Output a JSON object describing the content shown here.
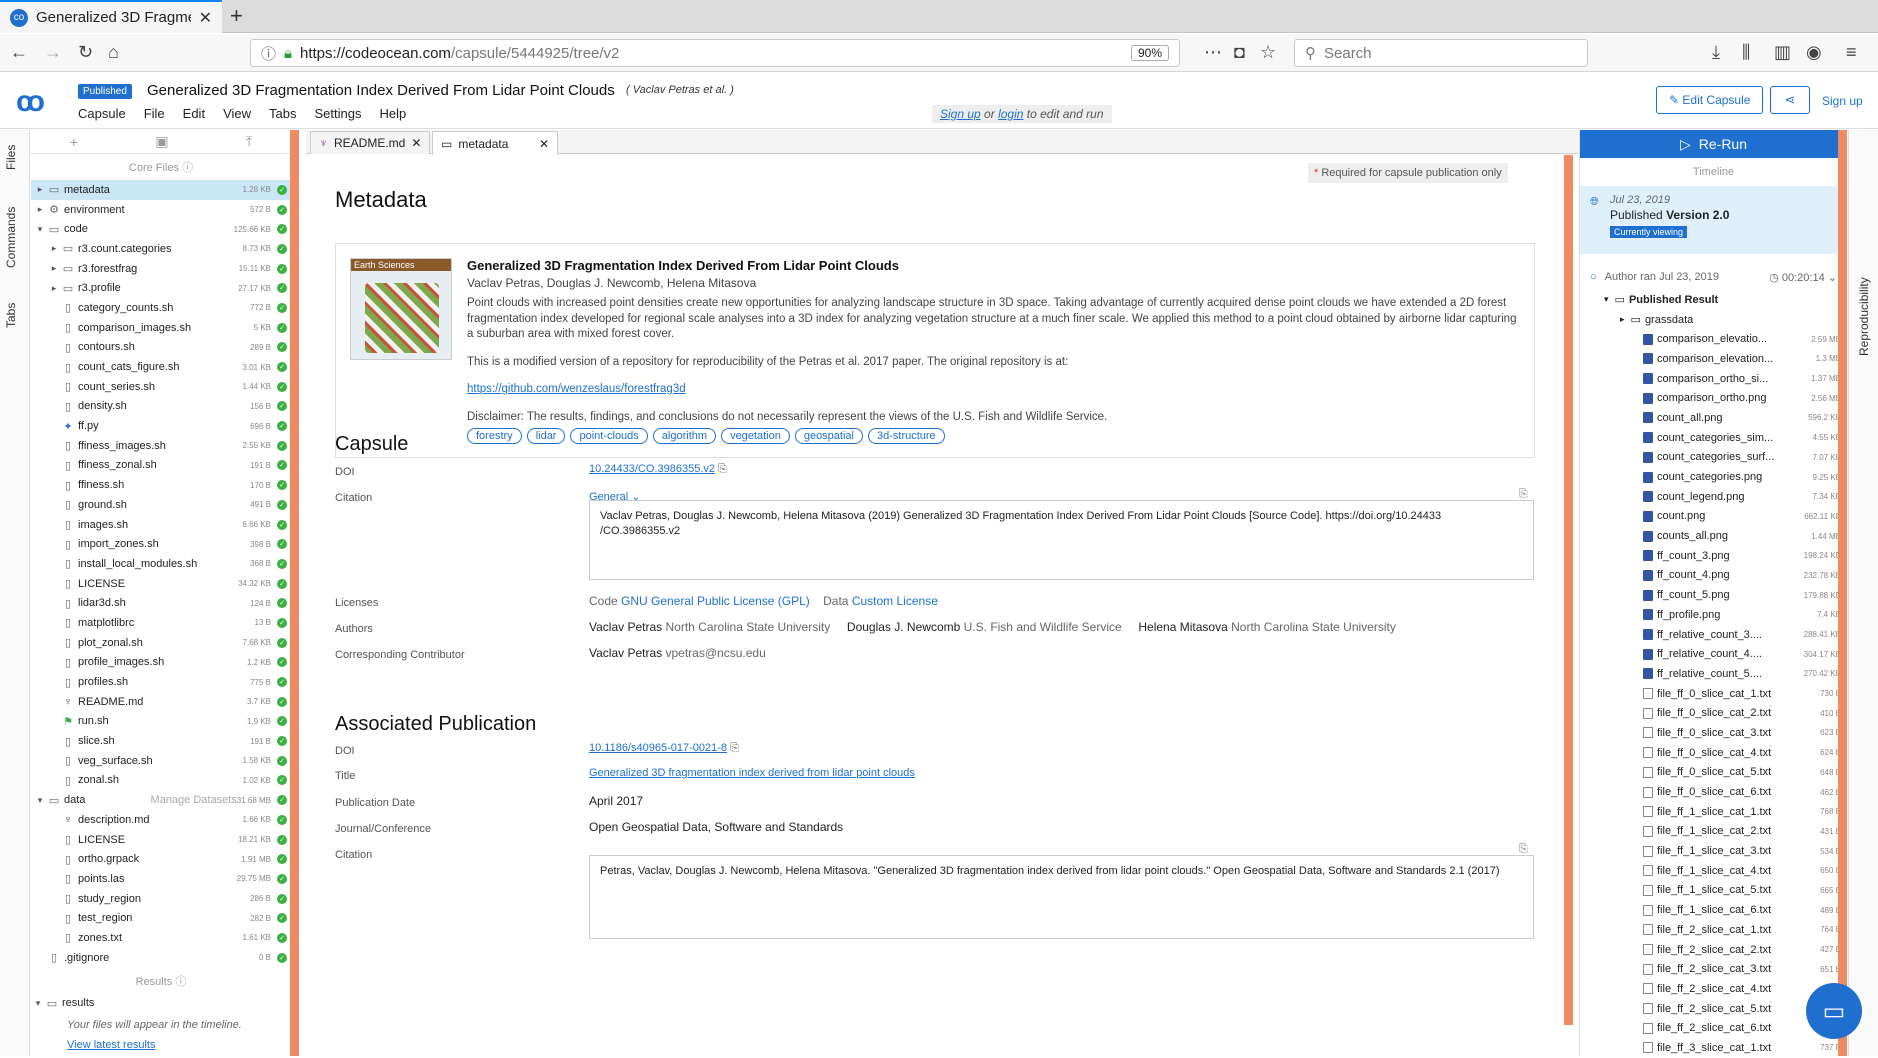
{
  "browser": {
    "tab_title": "Generalized 3D Fragmen",
    "url_host": "https://codeocean.com",
    "url_path": "/capsule/5444925/tree/v2",
    "zoom": "90%",
    "search_placeholder": "Search"
  },
  "app": {
    "badge": "Published",
    "title": "Generalized 3D Fragmentation Index Derived From Lidar Point Clouds",
    "authors": "( Vaclav Petras et al. )",
    "menu": [
      "Capsule",
      "File",
      "Edit",
      "View",
      "Tabs",
      "Settings",
      "Help"
    ],
    "signup_hint_link1": "Sign up",
    "signup_hint_or": "or",
    "signup_hint_link2": "login",
    "signup_hint_rest": "to edit and run",
    "edit_button": "Edit Capsule",
    "signup_button": "Sign up"
  },
  "rails": {
    "files": "Files",
    "commands": "Commands",
    "tabs": "Tabs",
    "reproducibility": "Reproducibility"
  },
  "files": {
    "core_label": "Core Files",
    "results_label": "Results",
    "tree": [
      {
        "name": "metadata",
        "size": "1.28 KB",
        "depth": 0,
        "caret": "▸",
        "icon": "▭",
        "sel": true
      },
      {
        "name": "environment",
        "size": "572 B",
        "depth": 0,
        "caret": "▸",
        "icon": "⚙"
      },
      {
        "name": "code",
        "size": "125.66 KB",
        "depth": 0,
        "caret": "▾",
        "icon": "▭"
      },
      {
        "name": "r3.count.categories",
        "size": "8.73 KB",
        "depth": 1,
        "caret": "▸",
        "icon": "▭"
      },
      {
        "name": "r3.forestfrag",
        "size": "15.11 KB",
        "depth": 1,
        "caret": "▸",
        "icon": "▭"
      },
      {
        "name": "r3.profile",
        "size": "27.17 KB",
        "depth": 1,
        "caret": "▸",
        "icon": "▭"
      },
      {
        "name": "category_counts.sh",
        "size": "772 B",
        "depth": 1
      },
      {
        "name": "comparison_images.sh",
        "size": "5 KB",
        "depth": 1
      },
      {
        "name": "contours.sh",
        "size": "289 B",
        "depth": 1
      },
      {
        "name": "count_cats_figure.sh",
        "size": "3.01 KB",
        "depth": 1
      },
      {
        "name": "count_series.sh",
        "size": "1.44 KB",
        "depth": 1
      },
      {
        "name": "density.sh",
        "size": "156 B",
        "depth": 1
      },
      {
        "name": "ff.py",
        "size": "696 B",
        "depth": 1,
        "icon": "✦"
      },
      {
        "name": "ffiness_images.sh",
        "size": "2.55 KB",
        "depth": 1
      },
      {
        "name": "ffiness_zonal.sh",
        "size": "191 B",
        "depth": 1
      },
      {
        "name": "ffiness.sh",
        "size": "170 B",
        "depth": 1
      },
      {
        "name": "ground.sh",
        "size": "491 B",
        "depth": 1
      },
      {
        "name": "images.sh",
        "size": "6.66 KB",
        "depth": 1
      },
      {
        "name": "import_zones.sh",
        "size": "398 B",
        "depth": 1
      },
      {
        "name": "install_local_modules.sh",
        "size": "368 B",
        "depth": 1
      },
      {
        "name": "LICENSE",
        "size": "34.32 KB",
        "depth": 1
      },
      {
        "name": "lidar3d.sh",
        "size": "124 B",
        "depth": 1
      },
      {
        "name": "matplotlibrc",
        "size": "13 B",
        "depth": 1
      },
      {
        "name": "plot_zonal.sh",
        "size": "7.68 KB",
        "depth": 1
      },
      {
        "name": "profile_images.sh",
        "size": "1.2 KB",
        "depth": 1
      },
      {
        "name": "profiles.sh",
        "size": "775 B",
        "depth": 1
      },
      {
        "name": "README.md",
        "size": "3.7 KB",
        "depth": 1,
        "icon": "♆"
      },
      {
        "name": "run.sh",
        "size": "1.9 KB",
        "depth": 1,
        "icon": "⚑"
      },
      {
        "name": "slice.sh",
        "size": "191 B",
        "depth": 1
      },
      {
        "name": "veg_surface.sh",
        "size": "1.58 KB",
        "depth": 1
      },
      {
        "name": "zonal.sh",
        "size": "1.02 KB",
        "depth": 1
      },
      {
        "name": "data",
        "size": "31.68 MB",
        "depth": 0,
        "caret": "▾",
        "icon": "▭",
        "hint": "Manage Datasets"
      },
      {
        "name": "description.md",
        "size": "1.66 KB",
        "depth": 1,
        "icon": "♆"
      },
      {
        "name": "LICENSE",
        "size": "18.21 KB",
        "depth": 1
      },
      {
        "name": "ortho.grpack",
        "size": "1.91 MB",
        "depth": 1
      },
      {
        "name": "points.las",
        "size": "29.75 MB",
        "depth": 1
      },
      {
        "name": "study_region",
        "size": "286 B",
        "depth": 1
      },
      {
        "name": "test_region",
        "size": "282 B",
        "depth": 1
      },
      {
        "name": "zones.txt",
        "size": "1.61 KB",
        "depth": 1
      },
      {
        "name": ".gitignore",
        "size": "0 B",
        "depth": 0
      }
    ],
    "results_folder": "results",
    "empty_msg": "Your files will appear in the timeline.",
    "view_latest": "View latest results"
  },
  "editor_tabs": [
    {
      "label": "README.md"
    },
    {
      "label": "metadata"
    }
  ],
  "metadata": {
    "required_note": "Required for capsule publication only",
    "heading": "Metadata",
    "thumb_tag": "Earth Sciences",
    "card_title": "Generalized 3D Fragmentation Index Derived From Lidar Point Clouds",
    "card_authors": "Vaclav Petras, Douglas J. Newcomb, Helena Mitasova",
    "desc1": "Point clouds with increased point densities create new opportunities for analyzing landscape structure in 3D space. Taking advantage of currently acquired dense point clouds we have extended a 2D forest fragmentation index developed for regional scale analyses into a 3D index for analyzing vegetation structure at a much finer scale. We applied this method to a point cloud obtained by airborne lidar capturing a suburban area with mixed forest cover.",
    "desc2": "This is a modified version of a repository for reproducibility of the Petras et al. 2017 paper. The original repository is at:",
    "desc_link": "https://github.com/wenzeslaus/forestfrag3d",
    "desc3": "Disclaimer: The results, findings, and conclusions do not necessarily represent the views of the U.S. Fish and Wildlife Service.",
    "tags": [
      "forestry",
      "lidar",
      "point-clouds",
      "algorithm",
      "vegetation",
      "geospatial",
      "3d-structure"
    ],
    "capsule_heading": "Capsule",
    "doi_label": "DOI",
    "doi": "10.24433/CO.3986355.v2",
    "citation_label": "Citation",
    "citation_style": "General",
    "citation": "Vaclav Petras, Douglas J. Newcomb, Helena Mitasova (2019) Generalized 3D Fragmentation Index Derived From Lidar Point Clouds [Source Code]. https://doi.org/10.24433 /CO.3986355.v2",
    "licenses_label": "Licenses",
    "code_label": "Code",
    "code_license": "GNU General Public License (GPL)",
    "data_label": "Data",
    "data_license": "Custom License",
    "authors_label": "Authors",
    "authors": [
      {
        "name": "Vaclav Petras",
        "aff": "North Carolina State University"
      },
      {
        "name": "Douglas J. Newcomb",
        "aff": "U.S. Fish and Wildlife Service"
      },
      {
        "name": "Helena Mitasova",
        "aff": "North Carolina State University"
      }
    ],
    "corr_label": "Corresponding Contributor",
    "corr_name": "Vaclav Petras",
    "corr_email": "vpetras@ncsu.edu",
    "pub_heading": "Associated Publication",
    "pub_doi": "10.1186/s40965-017-0021-8",
    "title_label": "Title",
    "pub_title": "Generalized 3D fragmentation index derived from lidar point clouds",
    "date_label": "Publication Date",
    "pub_date": "April 2017",
    "journal_label": "Journal/Conference",
    "journal": "Open Geospatial Data, Software and Standards",
    "pub_citation": "Petras, Vaclav, Douglas J. Newcomb, Helena Mitasova. \"Generalized 3D fragmentation index derived from lidar point clouds.\" Open Geospatial Data, Software and Standards 2.1 (2017)"
  },
  "timeline": {
    "rerun": "Re-Run",
    "heading": "Timeline",
    "pub_date": "Jul 23, 2019",
    "pub_prefix": "Published",
    "pub_version": "Version 2.0",
    "viewing": "Currently viewing",
    "run_label": "Author ran Jul 23, 2019",
    "run_duration": "00:20:14",
    "result_folder": "Published Result",
    "subfolder": "grassdata",
    "files": [
      {
        "name": "comparison_elevatio...",
        "size": "2.59 MB",
        "img": true
      },
      {
        "name": "comparison_elevation...",
        "size": "1.3 MB",
        "img": true
      },
      {
        "name": "comparison_ortho_si...",
        "size": "1.37 MB",
        "img": true
      },
      {
        "name": "comparison_ortho.png",
        "size": "2.56 MB",
        "img": true
      },
      {
        "name": "count_all.png",
        "size": "596.2 KB",
        "img": true
      },
      {
        "name": "count_categories_sim...",
        "size": "4.55 KB",
        "img": true
      },
      {
        "name": "count_categories_surf...",
        "size": "7.07 KB",
        "img": true
      },
      {
        "name": "count_categories.png",
        "size": "9.25 KB",
        "img": true
      },
      {
        "name": "count_legend.png",
        "size": "7.34 KB",
        "img": true
      },
      {
        "name": "count.png",
        "size": "662.11 KB",
        "img": true
      },
      {
        "name": "counts_all.png",
        "size": "1.44 MB",
        "img": true
      },
      {
        "name": "ff_count_3.png",
        "size": "198.24 KB",
        "img": true
      },
      {
        "name": "ff_count_4.png",
        "size": "232.78 KB",
        "img": true
      },
      {
        "name": "ff_count_5.png",
        "size": "179.88 KB",
        "img": true
      },
      {
        "name": "ff_profile.png",
        "size": "7.4 KB",
        "img": true
      },
      {
        "name": "ff_relative_count_3....",
        "size": "288.41 KB",
        "img": true
      },
      {
        "name": "ff_relative_count_4....",
        "size": "304.17 KB",
        "img": true
      },
      {
        "name": "ff_relative_count_5....",
        "size": "270.42 KB",
        "img": true
      },
      {
        "name": "file_ff_0_slice_cat_1.txt",
        "size": "730 B"
      },
      {
        "name": "file_ff_0_slice_cat_2.txt",
        "size": "410 B"
      },
      {
        "name": "file_ff_0_slice_cat_3.txt",
        "size": "623 B"
      },
      {
        "name": "file_ff_0_slice_cat_4.txt",
        "size": "624 B"
      },
      {
        "name": "file_ff_0_slice_cat_5.txt",
        "size": "648 B"
      },
      {
        "name": "file_ff_0_slice_cat_6.txt",
        "size": "462 B"
      },
      {
        "name": "file_ff_1_slice_cat_1.txt",
        "size": "768 B"
      },
      {
        "name": "file_ff_1_slice_cat_2.txt",
        "size": "431 B"
      },
      {
        "name": "file_ff_1_slice_cat_3.txt",
        "size": "534 B"
      },
      {
        "name": "file_ff_1_slice_cat_4.txt",
        "size": "650 B"
      },
      {
        "name": "file_ff_1_slice_cat_5.txt",
        "size": "665 B"
      },
      {
        "name": "file_ff_1_slice_cat_6.txt",
        "size": "489 B"
      },
      {
        "name": "file_ff_2_slice_cat_1.txt",
        "size": "764 B"
      },
      {
        "name": "file_ff_2_slice_cat_2.txt",
        "size": "427 B"
      },
      {
        "name": "file_ff_2_slice_cat_3.txt",
        "size": "651 B"
      },
      {
        "name": "file_ff_2_slice_cat_4.txt",
        "size": "65"
      },
      {
        "name": "file_ff_2_slice_cat_5.txt",
        "size": "66"
      },
      {
        "name": "file_ff_2_slice_cat_6.txt",
        "size": "48"
      },
      {
        "name": "file_ff_3_slice_cat_1.txt",
        "size": "737 B"
      }
    ]
  },
  "colors": {
    "accent": "#1f6fd1",
    "panel_edge": "#ef8a64",
    "ok": "#3cb043"
  }
}
